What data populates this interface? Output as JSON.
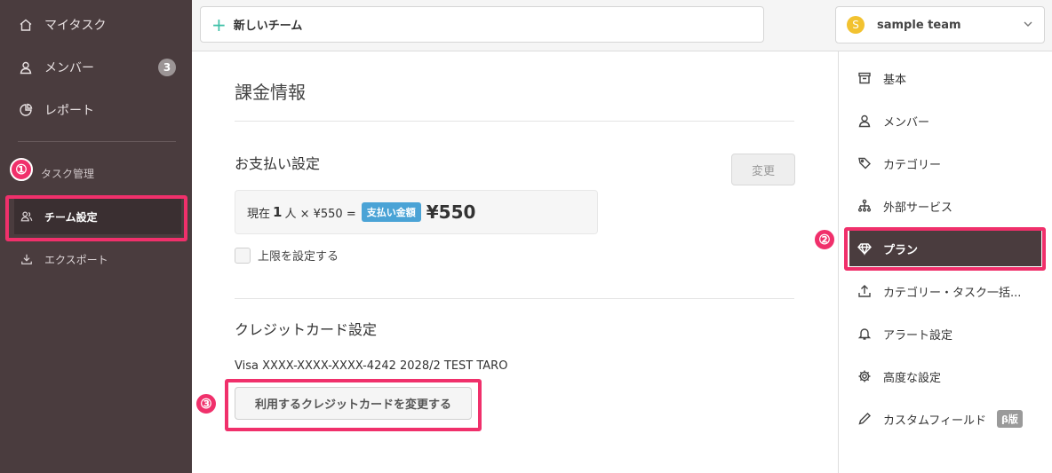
{
  "sidebar": {
    "nav": [
      {
        "label": "マイタスク",
        "icon": "home-icon"
      },
      {
        "label": "メンバー",
        "icon": "user-icon",
        "badge": "3"
      },
      {
        "label": "レポート",
        "icon": "pie-chart-icon"
      }
    ],
    "section_label": "タスク管理",
    "sub": [
      {
        "label": "チーム設定",
        "icon": "team-icon",
        "active": true
      },
      {
        "label": "エクスポート",
        "icon": "download-icon"
      }
    ]
  },
  "topbar": {
    "new_team_plus": "+",
    "new_team_label": "新しいチーム",
    "team_avatar": "S",
    "team_name": "sample team"
  },
  "main": {
    "page_title": "課金情報",
    "payment": {
      "title": "お支払い設定",
      "change_button": "変更",
      "current_prefix": "現在",
      "current_count": "1",
      "current_suffix": "人 × ¥550 =",
      "pay_label": "支払い金額",
      "total": "¥550",
      "limit_label": "上限を設定する"
    },
    "card": {
      "title": "クレジットカード設定",
      "info": "Visa XXXX-XXXX-XXXX-4242 2028/2 TEST TARO",
      "change_button": "利用するクレジットカードを変更する"
    }
  },
  "rightmenu": {
    "items": [
      {
        "label": "基本",
        "icon": "archive-icon"
      },
      {
        "label": "メンバー",
        "icon": "user-icon"
      },
      {
        "label": "カテゴリー",
        "icon": "tag-icon"
      },
      {
        "label": "外部サービス",
        "icon": "network-icon"
      },
      {
        "label": "プラン",
        "icon": "diamond-icon",
        "active": true
      },
      {
        "label": "カテゴリー・タスク一括...",
        "icon": "upload-icon"
      },
      {
        "label": "アラート設定",
        "icon": "bell-icon"
      },
      {
        "label": "高度な設定",
        "icon": "gear-icon"
      },
      {
        "label": "カスタムフィールド",
        "icon": "pencil-icon",
        "badge": "β版"
      }
    ]
  },
  "annotations": [
    "①",
    "②",
    "③"
  ],
  "colors": {
    "sidebar_bg": "#4a3c3e",
    "highlight": "#f0306b",
    "accent_green": "#3bbfa6",
    "pay_label": "#4aa3d6"
  }
}
